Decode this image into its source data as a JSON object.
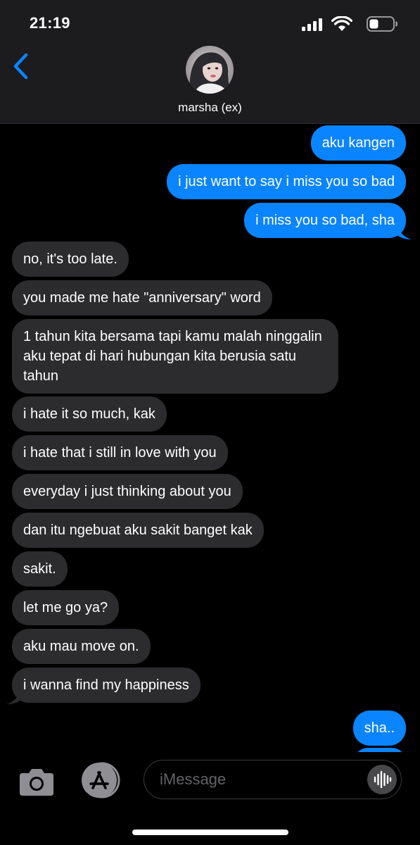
{
  "status_bar": {
    "time": "21:19"
  },
  "header": {
    "contact_name": "marsha (ex)",
    "back_icon": "chevron-left-icon",
    "accent": "#0a84ff"
  },
  "messages": [
    {
      "side": "sent",
      "text": "aku kangen"
    },
    {
      "side": "sent",
      "text": "i just want to say i miss you so bad"
    },
    {
      "side": "sent",
      "text": "i miss you so bad, sha"
    },
    {
      "side": "recv",
      "text": "no, it's too late."
    },
    {
      "side": "recv",
      "text": "you made me hate \"anniversary\" word"
    },
    {
      "side": "recv",
      "text": "1 tahun kita bersama tapi kamu malah ninggalin aku tepat di hari hubungan kita berusia satu tahun"
    },
    {
      "side": "recv",
      "text": "i hate it so much, kak"
    },
    {
      "side": "recv",
      "text": "i hate that i still in love with you"
    },
    {
      "side": "recv",
      "text": "everyday i just thinking about you"
    },
    {
      "side": "recv",
      "text": "dan itu ngebuat aku sakit banget kak"
    },
    {
      "side": "recv",
      "text": "sakit."
    },
    {
      "side": "recv",
      "text": "let me go ya?"
    },
    {
      "side": "recv",
      "text": "aku mau move on."
    },
    {
      "side": "recv",
      "text": "i wanna find my happiness"
    },
    {
      "side": "sent",
      "text": "sha.."
    }
  ],
  "input_bar": {
    "placeholder": "iMessage",
    "camera_icon": "camera-icon",
    "apps_icon": "app-store-icon",
    "audio_icon": "audio-waveform-icon"
  },
  "colors": {
    "sent_bubble": "#0a84ff",
    "received_bubble": "#2c2c2e",
    "background": "#000000"
  }
}
